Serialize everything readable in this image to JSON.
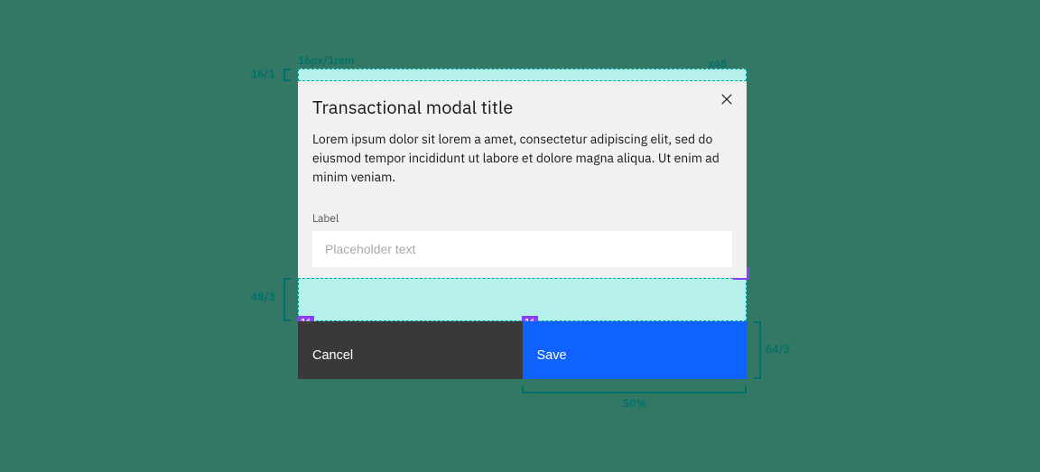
{
  "modal": {
    "title": "Transactional modal title",
    "body_text": "Lorem ipsum dolor sit lorem a amet, consectetur adipiscing elit, sed do eiusmod tempor incididunt ut labore et dolore magna aliqua. Ut enim ad minim veniam.",
    "input": {
      "label": "Label",
      "placeholder": "Placeholder text",
      "value": ""
    },
    "buttons": {
      "secondary": "Cancel",
      "primary": "Save"
    }
  },
  "spec": {
    "top_left_dim": "16px/1rem",
    "close_dim": "x48",
    "top_strip_bracket": "16/1",
    "gap_bracket": "48/3",
    "button_height_bracket": "64/3",
    "button_width_bracket": "50%",
    "padding_tag": "16"
  }
}
